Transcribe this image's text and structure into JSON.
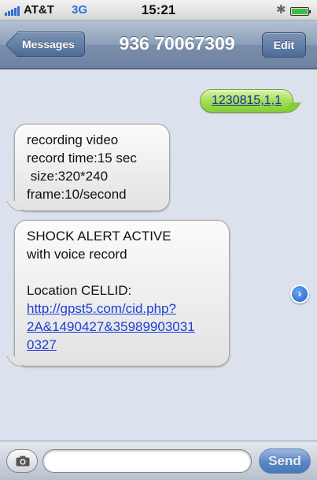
{
  "status_bar": {
    "carrier": "AT&T",
    "network": "3G",
    "time": "15:21",
    "bluetooth_icon": "bluetooth-icon",
    "battery_icon": "battery-icon"
  },
  "nav": {
    "back_label": "Messages",
    "title": "936 70067309",
    "edit_label": "Edit"
  },
  "messages": {
    "outgoing": [
      {
        "text": "1230815,1,1"
      }
    ],
    "incoming": [
      {
        "lines": [
          "recording video",
          "record time:15 sec",
          " size:320*240",
          "frame:10/second"
        ]
      },
      {
        "lines": [
          "SHOCK ALERT ACTIVE",
          "with voice record",
          "",
          "Location CELLID:"
        ],
        "link_lines": [
          "http://gpst5.com/cid.php?",
          "2A&1490427&35989903031",
          "0327"
        ]
      }
    ],
    "detail_icon": "chevron-right-circle-icon"
  },
  "composer": {
    "camera_icon": "camera-icon",
    "input_value": "",
    "input_placeholder": "",
    "send_label": "Send"
  },
  "colors": {
    "outgoing_bubble": "#9fdc54",
    "incoming_bubble": "#e2e2e2",
    "nav_bar": "#7b8eab",
    "link": "#1c3fd6",
    "thread_background": "#dbe2ed"
  }
}
